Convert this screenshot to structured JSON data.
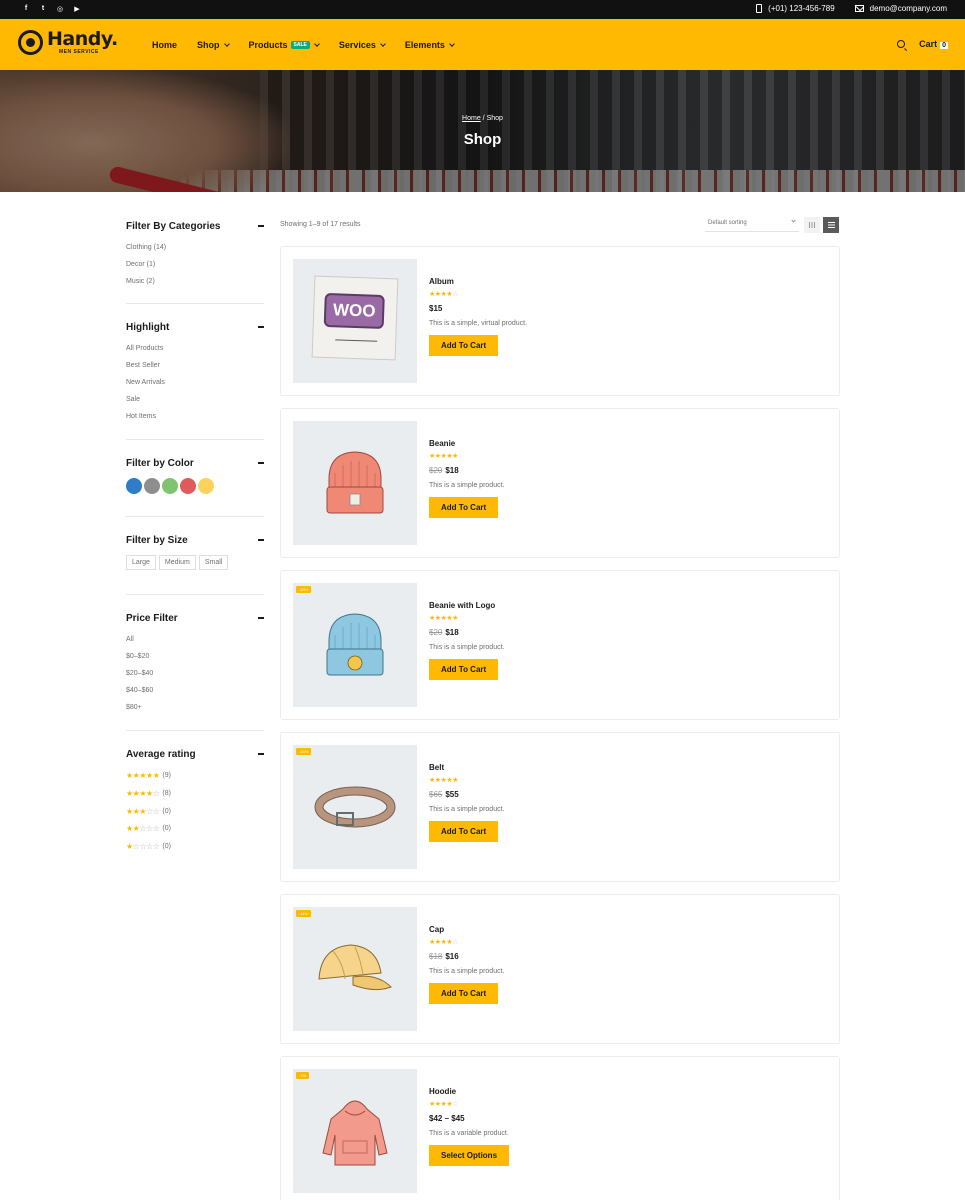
{
  "topbar": {
    "social": [
      {
        "icon": "facebook-icon",
        "glyph": "f"
      },
      {
        "icon": "twitter-icon",
        "glyph": "t"
      },
      {
        "icon": "instagram-icon",
        "glyph": "◎"
      },
      {
        "icon": "youtube-icon",
        "glyph": "▶"
      }
    ],
    "phone": "(+01) 123-456-789",
    "email": "demo@company.com"
  },
  "header": {
    "logo_name": "Handy.",
    "logo_sub": "MEN SERVICE",
    "nav": [
      {
        "label": "Home",
        "dropdown": false
      },
      {
        "label": "Shop",
        "dropdown": true
      },
      {
        "label": "Products",
        "dropdown": true,
        "badge": "SALE"
      },
      {
        "label": "Services",
        "dropdown": true
      },
      {
        "label": "Elements",
        "dropdown": true
      }
    ],
    "cart_label": "Cart",
    "cart_count": "0",
    "accent": "#ffb902"
  },
  "hero": {
    "breadcrumb_home": "Home",
    "breadcrumb_sep": " / ",
    "breadcrumb_current": "Shop",
    "title": "Shop"
  },
  "sidebar": {
    "categories": {
      "title": "Filter By Categories",
      "items": [
        "Clothing (14)",
        "Decor (1)",
        "Music (2)"
      ]
    },
    "highlight": {
      "title": "Highlight",
      "items": [
        "All Products",
        "Best Seller",
        "New Arrivals",
        "Sale",
        "Hot Items"
      ]
    },
    "color": {
      "title": "Filter by Color",
      "swatches": [
        "#2e7dc6",
        "#8e8e8e",
        "#7fc470",
        "#df5a5a",
        "#fbd35c"
      ]
    },
    "size": {
      "title": "Filter by Size",
      "items": [
        "Large",
        "Medium",
        "Small"
      ]
    },
    "price": {
      "title": "Price Filter",
      "items": [
        "All",
        "$0–$20",
        "$20–$40",
        "$40–$60",
        "$80+"
      ]
    },
    "rating": {
      "title": "Average rating",
      "items": [
        {
          "stars": 5,
          "count": "(9)"
        },
        {
          "stars": 4,
          "count": "(8)"
        },
        {
          "stars": 3,
          "count": "(0)"
        },
        {
          "stars": 2,
          "count": "(0)"
        },
        {
          "stars": 1,
          "count": "(0)"
        }
      ]
    }
  },
  "toolbar": {
    "results": "Showing 1–9 of 17 results",
    "sort": "Default sorting",
    "views": [
      "grid-view-icon",
      "list-view-icon"
    ]
  },
  "products": [
    {
      "name": "Album",
      "rating": 4,
      "old_price": "",
      "price": "$15",
      "desc": "This is a simple, virtual product.",
      "button": "Add To Cart",
      "badge": "",
      "image": "woo-album"
    },
    {
      "name": "Beanie",
      "rating": 5,
      "old_price": "$20",
      "price": "$18",
      "desc": "This is a simple product.",
      "button": "Add To Cart",
      "badge": "",
      "image": "beanie-red"
    },
    {
      "name": "Beanie with Logo",
      "rating": 5,
      "old_price": "$20",
      "price": "$18",
      "desc": "This is a simple product.",
      "button": "Add To Cart",
      "badge": "-10%",
      "image": "beanie-blue"
    },
    {
      "name": "Belt",
      "rating": 5,
      "old_price": "$65",
      "price": "$55",
      "desc": "This is a simple product.",
      "button": "Add To Cart",
      "badge": "-15%",
      "image": "belt"
    },
    {
      "name": "Cap",
      "rating": 4,
      "old_price": "$18",
      "price": "$16",
      "desc": "This is a simple product.",
      "button": "Add To Cart",
      "badge": "-11%",
      "image": "cap"
    },
    {
      "name": "Hoodie",
      "rating": 4,
      "old_price": "",
      "price": "$42 – $45",
      "desc": "This is a variable product.",
      "button": "Select Options",
      "badge": "-7%",
      "image": "hoodie"
    }
  ]
}
